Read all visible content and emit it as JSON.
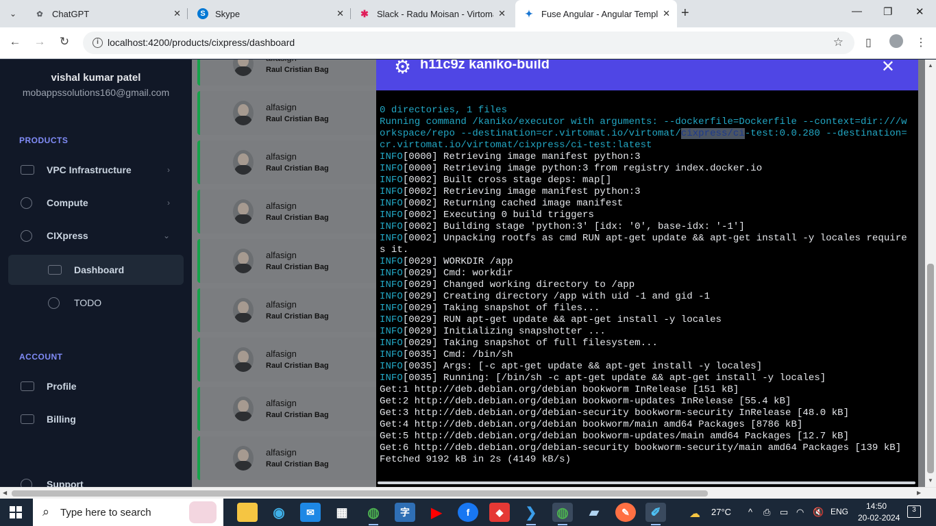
{
  "browser": {
    "tabs": [
      {
        "label": "ChatGPT",
        "icon": "chatgpt-icon",
        "color": "#10a37f"
      },
      {
        "label": "Skype",
        "icon": "skype-icon",
        "color": "#0078d4"
      },
      {
        "label": "Slack - Radu Moisan - Virtomat",
        "icon": "slack-icon",
        "color": "#e01e5a"
      },
      {
        "label": "Fuse Angular - Angular Templat",
        "icon": "angular-icon",
        "color": "#1976d2"
      }
    ],
    "url": "localhost:4200/products/cixpress/dashboard"
  },
  "sidebar": {
    "user_name": "vishal kumar patel",
    "user_email": "mobappssolutions160@gmail.com",
    "products_header": "PRODUCTS",
    "products": [
      {
        "label": "VPC Infrastructure",
        "icon": "database-icon"
      },
      {
        "label": "Compute",
        "icon": "chart-pie-icon"
      },
      {
        "label": "CIXpress",
        "icon": "chart-pie-icon"
      }
    ],
    "cixpress_children": [
      {
        "label": "Dashboard",
        "icon": "database-icon",
        "active": true
      },
      {
        "label": "TODO",
        "icon": "chart-pie-icon"
      }
    ],
    "account_header": "ACCOUNT",
    "account": [
      {
        "label": "Profile",
        "icon": "database-icon"
      },
      {
        "label": "Billing",
        "icon": "database-icon"
      }
    ],
    "support_label": "Support"
  },
  "cards": [
    {
      "title": "",
      "subtitle": "Raul Cristian Bag"
    },
    {
      "title": "alfasign",
      "subtitle": "Raul Cristian Bag"
    },
    {
      "title": "alfasign",
      "subtitle": "Raul Cristian Bag"
    },
    {
      "title": "alfasign",
      "subtitle": "Raul Cristian Bag"
    },
    {
      "title": "alfasign",
      "subtitle": "Raul Cristian Bag"
    },
    {
      "title": "alfasign",
      "subtitle": "Raul Cristian Bag"
    },
    {
      "title": "alfasign",
      "subtitle": "Raul Cristian Bag"
    },
    {
      "title": "alfasign",
      "subtitle": "Raul Cristian Bag"
    },
    {
      "title": "alfasign",
      "subtitle": "Raul Cristian Bag"
    }
  ],
  "card_top_title": "alfasign",
  "modal": {
    "title": "h11c9z kaniko-build",
    "colors": {
      "header": "#4f46e5",
      "info": "#22a7c4"
    },
    "log_header": [
      "0 directories, 1 files",
      "Running command /kaniko/executor with arguments: --dockerfile=Dockerfile --context=dir:///workspace/repo --destination=cr.virtomat.io/virtomat/"
    ],
    "log_highlight": "cixpress/ci",
    "log_header_tail": "-test:0.0.280 --destination=cr.virtomat.io/virtomat/cixpress/ci-test:latest",
    "info_prefix": "INFO",
    "info_lines": [
      "[0000] Retrieving image manifest python:3",
      "[0000] Retrieving image python:3 from registry index.docker.io",
      "[0002] Built cross stage deps: map[]",
      "[0002] Retrieving image manifest python:3",
      "[0002] Returning cached image manifest",
      "[0002] Executing 0 build triggers",
      "[0002] Building stage 'python:3' [idx: '0', base-idx: '-1']",
      "[0002] Unpacking rootfs as cmd RUN apt-get update && apt-get install -y locales requires it.",
      "[0029] WORKDIR /app",
      "[0029] Cmd: workdir",
      "[0029] Changed working directory to /app",
      "[0029] Creating directory /app with uid -1 and gid -1",
      "[0029] Taking snapshot of files...",
      "[0029] RUN apt-get update && apt-get install -y locales",
      "[0029] Initializing snapshotter ...",
      "[0029] Taking snapshot of full filesystem...",
      "[0035] Cmd: /bin/sh",
      "[0035] Args: [-c apt-get update && apt-get install -y locales]",
      "[0035] Running: [/bin/sh -c apt-get update && apt-get install -y locales]"
    ],
    "plain_lines": [
      "Get:1 http://deb.debian.org/debian bookworm InRelease [151 kB]",
      "Get:2 http://deb.debian.org/debian bookworm-updates InRelease [55.4 kB]",
      "Get:3 http://deb.debian.org/debian-security bookworm-security InRelease [48.0 kB]",
      "Get:4 http://deb.debian.org/debian bookworm/main amd64 Packages [8786 kB]",
      "Get:5 http://deb.debian.org/debian bookworm-updates/main amd64 Packages [12.7 kB]",
      "Get:6 http://deb.debian.org/debian-security bookworm-security/main amd64 Packages [139 kB]",
      "Fetched 9192 kB in 2s (4149 kB/s)"
    ]
  },
  "taskbar": {
    "search_placeholder": "Type here to search",
    "weather": "27°C",
    "language": "ENG",
    "time": "14:50",
    "date": "20-02-2024",
    "notifications": "3"
  }
}
